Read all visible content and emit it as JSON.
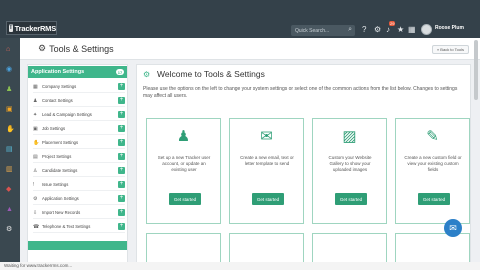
{
  "app": {
    "logo": "TrackerRMS"
  },
  "topbar": {
    "search_placeholder": "Quick Search...",
    "notif_badge": "29",
    "user_name": "Roose Plum"
  },
  "header": {
    "title": "Tools & Settings",
    "back_label": "« Back to Tools"
  },
  "sidebar": {
    "title": "Application Settings",
    "count": "17",
    "items": [
      {
        "label": "Company Settings",
        "icon": "building-icon"
      },
      {
        "label": "Contact Settings",
        "icon": "person-icon"
      },
      {
        "label": "Lead & Campaign Settings",
        "icon": "lead-icon"
      },
      {
        "label": "Job Settings",
        "icon": "briefcase-icon"
      },
      {
        "label": "Placement Settings",
        "icon": "handshake-icon"
      },
      {
        "label": "Project Settings",
        "icon": "folder-icon"
      },
      {
        "label": "Candidate Settings",
        "icon": "user-icon"
      },
      {
        "label": "Issue Settings",
        "icon": "issue-icon"
      },
      {
        "label": "Application Settings",
        "icon": "gear-icon"
      },
      {
        "label": "Import New Records",
        "icon": "import-icon"
      },
      {
        "label": "Telephone & Text Settings",
        "icon": "phone-icon"
      }
    ]
  },
  "main": {
    "welcome": "Welcome to Tools & Settings",
    "description": "Please use the options on the left to change your system settings or select one of the common actions from the list below. Changes to settings may affect all users.",
    "cards": [
      {
        "text": "Set up a new Tracker user account, or update an existing user",
        "button": "Get started",
        "icon": "user-icon"
      },
      {
        "text": "Create a new email, text or letter template to send",
        "button": "Get started",
        "icon": "envelope-icon"
      },
      {
        "text": "Custom your Website Gallery to show your uploaded images",
        "button": "Get started",
        "icon": "image-icon"
      },
      {
        "text": "Create a new custom field or view your existing custom fields",
        "button": "Get started",
        "icon": "pen-icon"
      }
    ]
  },
  "status": {
    "text": "Waiting for www.trackerrms.com..."
  }
}
